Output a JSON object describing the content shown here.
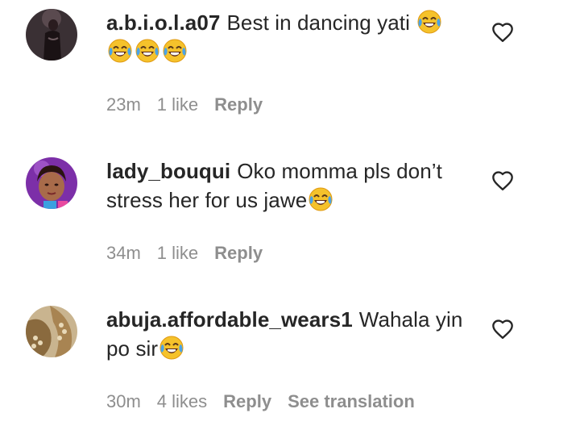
{
  "comments": [
    {
      "username": "a.b.i.o.l.a07",
      "text": "Best in dancing yati",
      "text_line2": "",
      "emojis_inline": 1,
      "emojis_line2": 3,
      "time": "23m",
      "likes": "1 like",
      "reply": "Reply",
      "translate": "",
      "avatar": "avatar-dark-figure"
    },
    {
      "username": "lady_bouqui",
      "text": "Oko momma pls don’t stress her for us jawe",
      "text_line2": "",
      "emojis_inline": 1,
      "emojis_line2": 0,
      "time": "34m",
      "likes": "1 like",
      "reply": "Reply",
      "translate": "",
      "avatar": "avatar-woman-purple"
    },
    {
      "username": "abuja.affordable_wears1",
      "text": "Wahala yin po sir",
      "text_line2": "",
      "emojis_inline": 1,
      "emojis_line2": 0,
      "time": "30m",
      "likes": "4 likes",
      "reply": "Reply",
      "translate": "See translation",
      "avatar": "avatar-shoes"
    }
  ],
  "icons": {
    "like": "heart-outline-icon",
    "emoji": "face-with-tears-of-joy"
  },
  "colors": {
    "text": "#262626",
    "meta": "#8e8e8e",
    "background": "#ffffff"
  }
}
